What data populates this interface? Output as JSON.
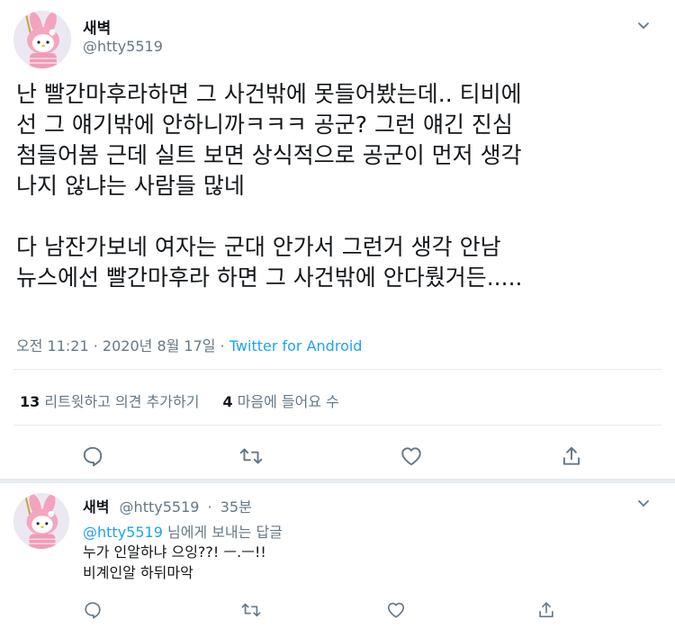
{
  "tweet": {
    "display_name": "새벽",
    "handle": "@htty5519",
    "body": "난 빨간마후라하면 그 사건밖에 못들어봤는데.. 티비에\n선 그 얘기밖에 안하니까ㅋㅋㅋ 공군? 그런 얘긴 진심\n첨들어봄 근데 실트 보면 상식적으로 공군이 먼저 생각\n나지 않냐는 사람들 많네\n\n다 남잔가보네 여자는 군대 안가서 그런거 생각 안남\n뉴스에선 빨간마후라 하면 그 사건밖에 안다뤘거든.....",
    "time": "오전 11:21",
    "dot": "·",
    "date": "2020년 8월 17일",
    "source": "Twitter for Android",
    "retweet_count": "13",
    "retweet_label": "리트윗하고 의견 추가하기",
    "like_count": "4",
    "like_label": "마음에 들어요 수"
  },
  "reply": {
    "display_name": "새벽",
    "handle": "@htty5519",
    "dot": "·",
    "time_ago": "35분",
    "replying_mention": "@htty5519",
    "replying_suffix": "님에게 보내는 답글",
    "body": "누가 인알하냐 으잉??! ㅡ.ㅡ!!\n비계인알 하뒤마악"
  },
  "icons": {
    "reply": "reply-icon",
    "retweet": "retweet-icon",
    "like": "heart-icon",
    "share": "share-icon",
    "more": "chevron-down-icon"
  },
  "colors": {
    "accent": "#1da1f2",
    "secondary_text": "#657786",
    "divider": "#e6ecf0"
  }
}
